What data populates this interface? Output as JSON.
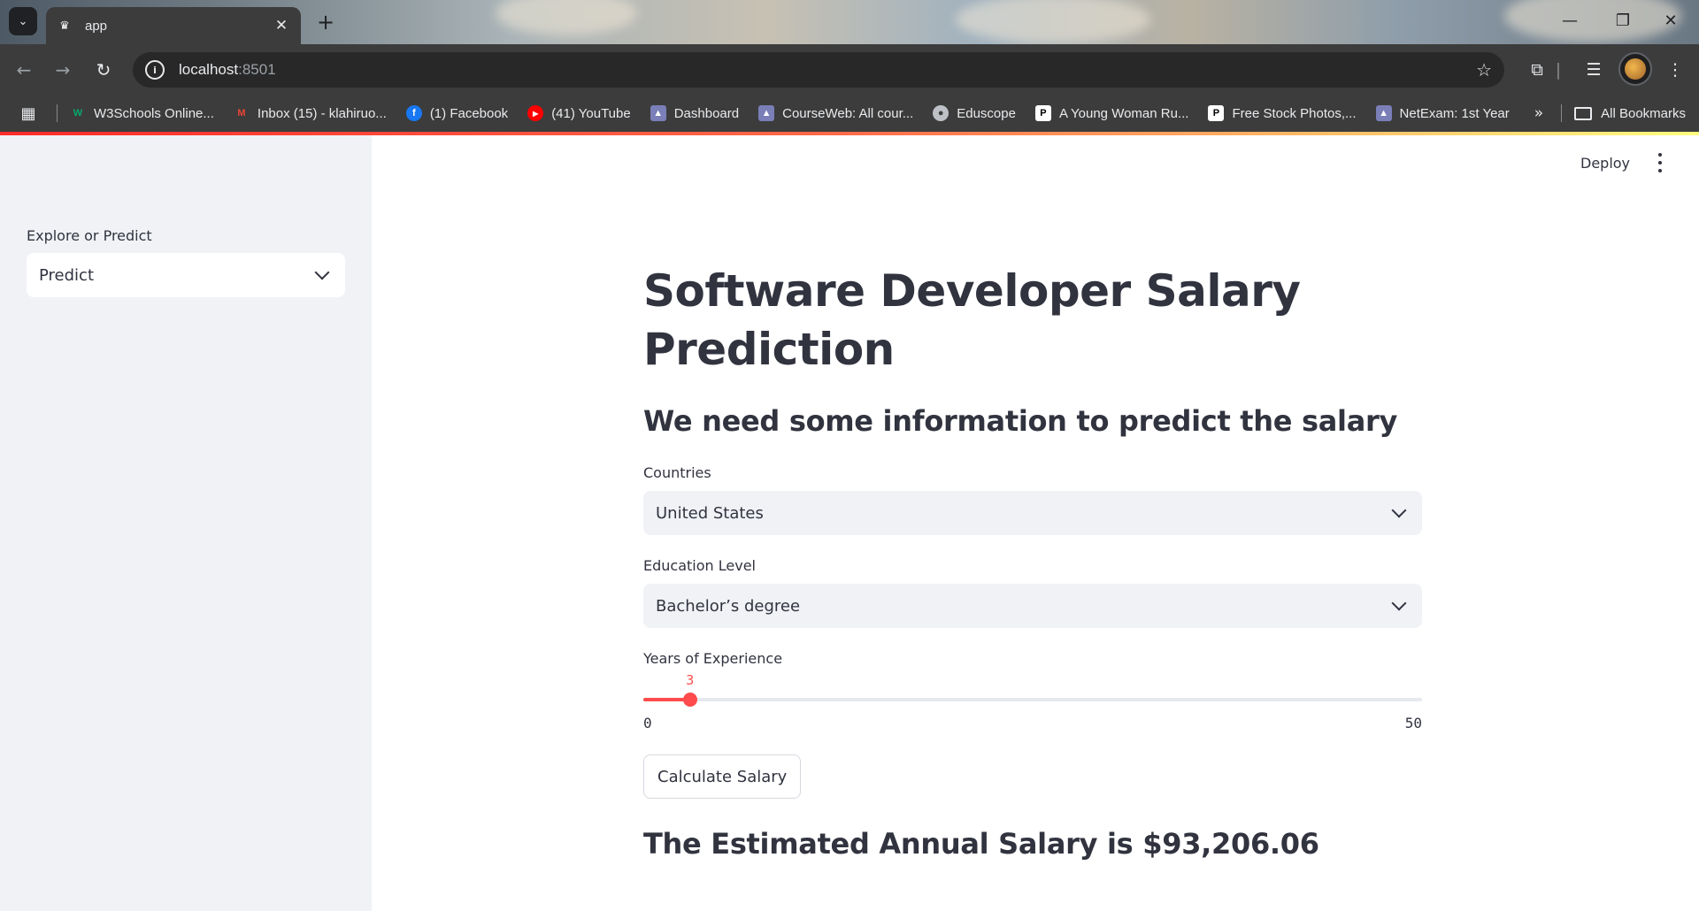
{
  "browser": {
    "tab_title": "app",
    "url_host": "localhost",
    "url_port": ":8501",
    "bookmarks": [
      {
        "label": "W3Schools Online...",
        "icon": "w3schools-icon",
        "color": "#04aa6d"
      },
      {
        "label": "Inbox (15) - klahiruo...",
        "icon": "gmail-icon",
        "color": "#ea4335"
      },
      {
        "label": "(1) Facebook",
        "icon": "facebook-icon",
        "color": "#1877f2"
      },
      {
        "label": "(41) YouTube",
        "icon": "youtube-icon",
        "color": "#ff0000"
      },
      {
        "label": "Dashboard",
        "icon": "university-icon",
        "color": "#7a7fb8"
      },
      {
        "label": "CourseWeb: All cour...",
        "icon": "university-icon",
        "color": "#7a7fb8"
      },
      {
        "label": "Eduscope",
        "icon": "globe-icon",
        "color": "#bdc1c6"
      },
      {
        "label": "A Young Woman Ru...",
        "icon": "pexels-icon",
        "color": "#ffffff"
      },
      {
        "label": "Free Stock Photos,...",
        "icon": "pexels-icon",
        "color": "#ffffff"
      },
      {
        "label": "NetExam: 1st Year",
        "icon": "university-icon",
        "color": "#7a7fb8"
      }
    ],
    "all_bookmarks": "All Bookmarks"
  },
  "sidebar": {
    "label": "Explore or Predict",
    "selected": "Predict"
  },
  "header": {
    "deploy": "Deploy"
  },
  "main": {
    "title": "Software Developer Salary Prediction",
    "subtitle": "We need some information to predict the salary",
    "countries_label": "Countries",
    "countries_value": "United States",
    "education_label": "Education Level",
    "education_value": "Bachelor’s degree",
    "experience_label": "Years of Experience",
    "experience": {
      "value": 3,
      "min": 0,
      "max": 50
    },
    "button_label": "Calculate Salary",
    "result": "The Estimated Annual Salary is $93,206.06"
  },
  "colors": {
    "accent": "#ff4b4b",
    "sidebar_bg": "#f0f2f6",
    "text": "#31333f"
  }
}
